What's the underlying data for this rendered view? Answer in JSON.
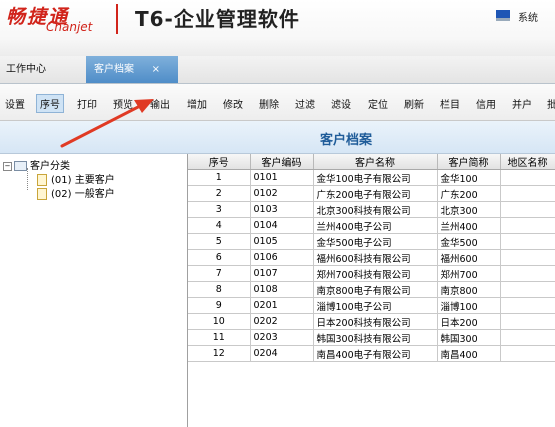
{
  "header": {
    "logo_cn": "畅捷通",
    "logo_en": "Chanjet",
    "product_title": "T6-企业管理软件",
    "system_label": "系统"
  },
  "tabs": {
    "home": "工作中心",
    "active": "客户档案",
    "close": "×"
  },
  "toolbar": [
    "设置",
    "序号",
    "打印",
    "预览",
    "输出",
    "增加",
    "修改",
    "删除",
    "过滤",
    "滤设",
    "定位",
    "刷新",
    "栏目",
    "信用",
    "并户",
    "批"
  ],
  "page_title": "客户档案",
  "tree": {
    "root": "客户分类",
    "children": [
      "(01) 主要客户",
      "(02) 一般客户"
    ]
  },
  "grid": {
    "columns": [
      "序号",
      "客户编码",
      "客户名称",
      "客户简称",
      "地区名称"
    ],
    "rows": [
      [
        "1",
        "0101",
        "金华100电子有限公司",
        "金华100",
        ""
      ],
      [
        "2",
        "0102",
        "广东200电子有限公司",
        "广东200",
        ""
      ],
      [
        "3",
        "0103",
        "北京300科技有限公司",
        "北京300",
        ""
      ],
      [
        "4",
        "0104",
        "兰州400电子公司",
        "兰州400",
        ""
      ],
      [
        "5",
        "0105",
        "金华500电子公司",
        "金华500",
        ""
      ],
      [
        "6",
        "0106",
        "福州600科技有限公司",
        "福州600",
        ""
      ],
      [
        "7",
        "0107",
        "郑州700科技有限公司",
        "郑州700",
        ""
      ],
      [
        "8",
        "0108",
        "南京800电子有限公司",
        "南京800",
        ""
      ],
      [
        "9",
        "0201",
        "淄博100电子公司",
        "淄博100",
        ""
      ],
      [
        "10",
        "0202",
        "日本200科技有限公司",
        "日本200",
        ""
      ],
      [
        "11",
        "0203",
        "韩国300科技有限公司",
        "韩国300",
        ""
      ],
      [
        "12",
        "0204",
        "南昌400电子有限公司",
        "南昌400",
        ""
      ]
    ]
  },
  "colors": {
    "brand_red": "#d1241b",
    "tab_active_blue": "#4f8dc8",
    "title_blue": "#1f5c99",
    "annotation_arrow": "#e03a24"
  }
}
